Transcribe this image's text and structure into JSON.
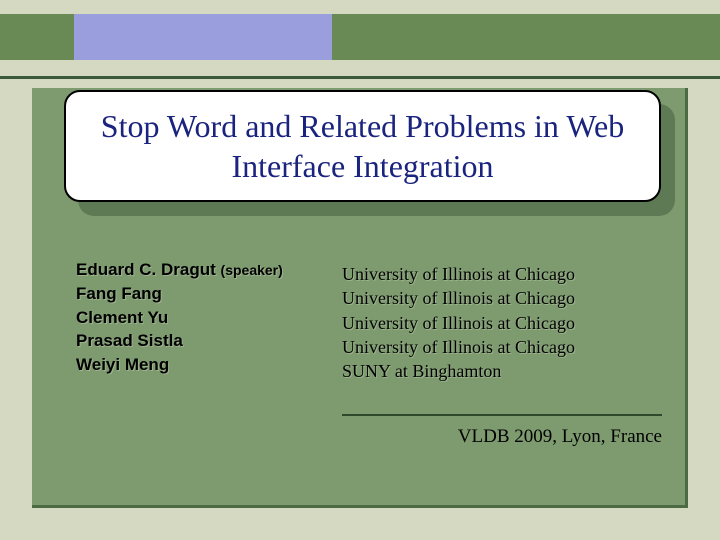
{
  "title": "Stop Word and Related Problems in Web Interface Integration",
  "authors": {
    "line1_name": "Eduard C. Dragut",
    "line1_role": "(speaker)",
    "line2": "Fang Fang",
    "line3": "Clement Yu",
    "line4": "Prasad Sistla",
    "line5": "Weiyi Meng"
  },
  "affiliations": {
    "line1": "University of Illinois at Chicago",
    "line2": "University of Illinois at Chicago",
    "line3": "University of Illinois at Chicago",
    "line4": "University of Illinois at Chicago",
    "line5": "SUNY at Binghamton"
  },
  "venue": "VLDB 2009, Lyon, France",
  "colors": {
    "slide_bg": "#d5d9c1",
    "accent_green": "#7e9b6f",
    "accent_purple": "#9a9edc",
    "title_color": "#1a237e"
  }
}
